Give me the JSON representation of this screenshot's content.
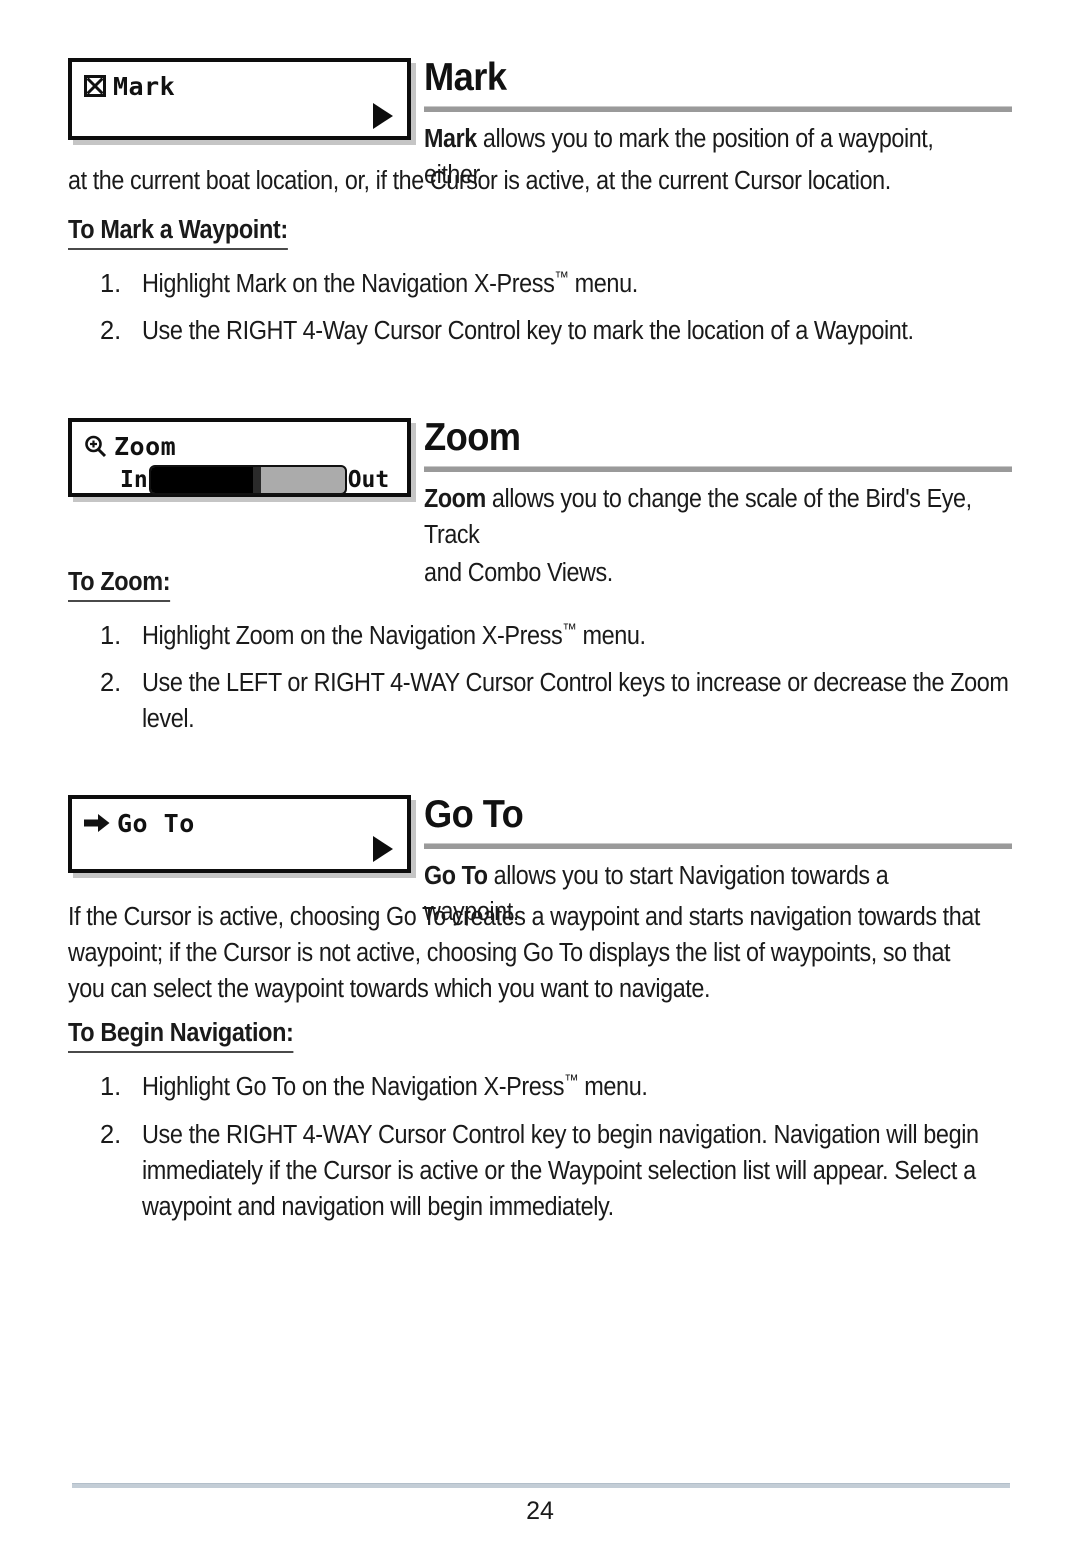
{
  "page": {
    "number": "24"
  },
  "sections": [
    {
      "id": "mark",
      "widget": {
        "icon": "waypoint-crossed-box-icon",
        "label": "Mark",
        "arrow": "right-triangle-icon"
      },
      "title": "Mark",
      "intro_lead": "Mark",
      "intro_rest": " allows you to mark the position of a waypoint, either",
      "intro_continued": "at the current boat location, or, if the Cursor is active, at the current Cursor location.",
      "subhead": "To Mark a Waypoint:",
      "steps": [
        {
          "num": "1.",
          "text_pre": "Highlight Mark on the Navigation X-Press",
          "tm": "™",
          "text_post": " menu."
        },
        {
          "num": "2.",
          "text_pre": "Use the RIGHT 4-Way Cursor Control key to mark the location of a Waypoint.",
          "tm": "",
          "text_post": ""
        }
      ]
    },
    {
      "id": "zoom",
      "widget": {
        "icon": "magnifier-plus-icon",
        "label": "Zoom",
        "slider": {
          "left_label": "In",
          "right_label": "Out",
          "fill_percent": 55
        }
      },
      "title": "Zoom",
      "intro_lead": "Zoom",
      "intro_rest": " allows you to change the scale of the Bird's Eye, Track",
      "intro_continued": "and Combo Views.",
      "subhead": "To Zoom:",
      "steps": [
        {
          "num": "1.",
          "text_pre": "Highlight Zoom on the Navigation X-Press",
          "tm": "™",
          "text_post": " menu."
        },
        {
          "num": "2.",
          "text_pre": "Use the LEFT or RIGHT 4-WAY Cursor Control keys to increase or decrease the Zoom level.",
          "tm": "",
          "text_post": ""
        }
      ]
    },
    {
      "id": "goto",
      "widget": {
        "icon": "arrow-right-icon",
        "label": "Go To",
        "arrow": "right-triangle-icon"
      },
      "title": "Go To",
      "intro_lead": "Go To",
      "intro_rest": " allows you to start Navigation towards a waypoint.",
      "intro_continued": "If the Cursor is active, choosing Go To creates a waypoint and starts navigation towards that waypoint; if the Cursor is not active, choosing Go To displays the list of waypoints, so that you can select the waypoint towards which you want to navigate.",
      "subhead": "To Begin Navigation:",
      "steps": [
        {
          "num": "1.",
          "text_pre": "Highlight Go To on the Navigation X-Press",
          "tm": "™",
          "text_post": " menu."
        },
        {
          "num": "2.",
          "text_pre": "Use the RIGHT 4-WAY Cursor Control key to begin navigation.  Navigation will begin immediately if the Cursor is active or the Waypoint selection list will appear.  Select a waypoint and navigation will begin immediately.",
          "tm": "",
          "text_post": ""
        }
      ]
    }
  ],
  "colors": {
    "rule_gray": "#9a9a9a",
    "footer_rule": "#c3cdd6",
    "ink": "#1a1a1a"
  }
}
